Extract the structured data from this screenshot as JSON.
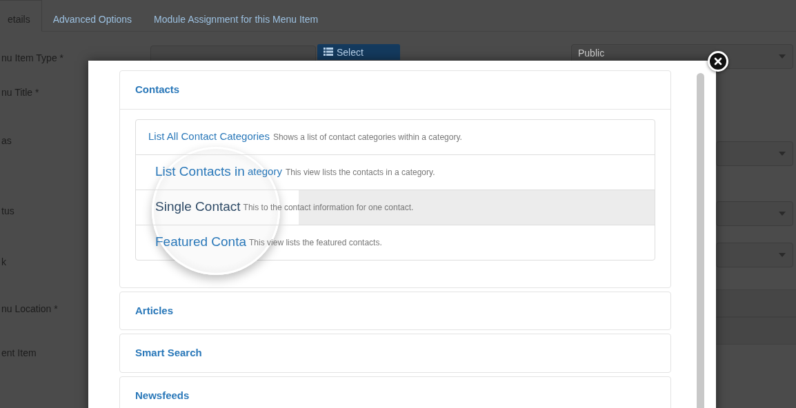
{
  "tabs": [
    {
      "label": "etails",
      "selected": true
    },
    {
      "label": "Advanced Options",
      "selected": false
    },
    {
      "label": "Module Assignment for this Menu Item",
      "selected": false
    }
  ],
  "form_labels": [
    "nu Item Type *",
    "nu Title *",
    "as",
    "tus",
    "k",
    "nu Location *",
    "ent Item"
  ],
  "select_button": {
    "label": "Select"
  },
  "access": {
    "value": "Public"
  },
  "modal": {
    "groups": [
      {
        "title": "Contacts",
        "expanded": true,
        "items": [
          {
            "title": "List All Contact Categories",
            "description": "Shows a list of contact categories within a category.",
            "selected": false
          },
          {
            "lens_title": "List Contacts in",
            "title": "ategory",
            "description": "This view lists the contacts in a category.",
            "selected": false
          },
          {
            "lens_title": "Single Contact",
            "description": "This to the contact information for one contact.",
            "selected": true
          },
          {
            "lens_title": "Featured Conta",
            "description": "This view lists the featured contacts.",
            "selected": false
          }
        ]
      },
      {
        "title": "Articles",
        "expanded": false
      },
      {
        "title": "Smart Search",
        "expanded": false
      },
      {
        "title": "Newsfeeds",
        "expanded": false
      }
    ]
  }
}
